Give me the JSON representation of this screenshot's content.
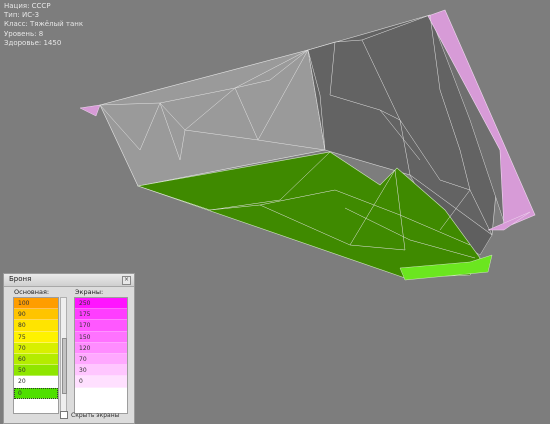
{
  "info": {
    "nation": "Нация: СССР",
    "type": "Тип: ИС-3",
    "class": "Класс: Тяжёлый танк",
    "tier": "Уровень: 8",
    "health": "Здоровье: 1450"
  },
  "panel": {
    "title": "Броня",
    "close_icon": "close-icon",
    "base_header": "Основная:",
    "screens_header": "Экраны:",
    "base_items": [
      {
        "label": "100",
        "color": "#ff9d00"
      },
      {
        "label": "90",
        "color": "#ffc400"
      },
      {
        "label": "80",
        "color": "#ffe400"
      },
      {
        "label": "75",
        "color": "#fff200"
      },
      {
        "label": "70",
        "color": "#d8f000"
      },
      {
        "label": "60",
        "color": "#b4ec00"
      },
      {
        "label": "50",
        "color": "#8fe600"
      },
      {
        "label": "20",
        "color": "#ffffff"
      },
      {
        "label": "0",
        "color": "#4fe000"
      }
    ],
    "screen_items": [
      {
        "label": "250",
        "color": "#ff14ff"
      },
      {
        "label": "175",
        "color": "#ff3dff"
      },
      {
        "label": "170",
        "color": "#ff58ff"
      },
      {
        "label": "150",
        "color": "#ff72ff"
      },
      {
        "label": "120",
        "color": "#ff8cff"
      },
      {
        "label": "70",
        "color": "#ffa8ff"
      },
      {
        "label": "30",
        "color": "#ffc6ff"
      },
      {
        "label": "0",
        "color": "#ffe0ff"
      }
    ],
    "hide_screens_label": "Скрыть экраны"
  }
}
